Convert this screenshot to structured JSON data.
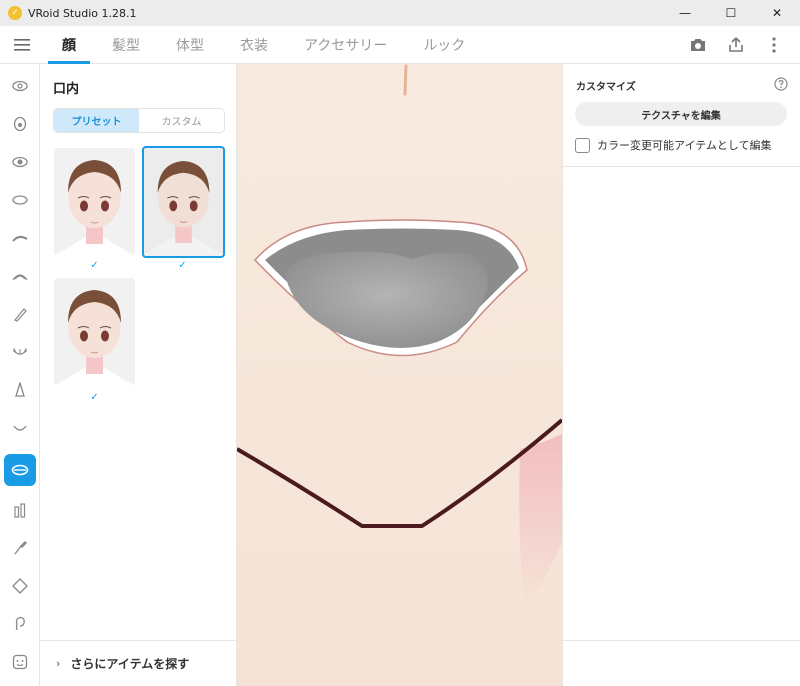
{
  "window": {
    "title": "VRoid Studio 1.28.1",
    "controls": {
      "minimize": "—",
      "maximize": "☐",
      "close": "✕"
    }
  },
  "nav": {
    "tabs": [
      {
        "label": "顔",
        "active": true
      },
      {
        "label": "髪型"
      },
      {
        "label": "体型"
      },
      {
        "label": "衣装"
      },
      {
        "label": "アクセサリー"
      },
      {
        "label": "ルック"
      }
    ],
    "actions": [
      "camera-icon",
      "export-icon",
      "more-icon"
    ]
  },
  "rail": {
    "items": [
      "face-outline-icon",
      "eye-icon",
      "eye-highlight-icon",
      "iris-icon",
      "eyebrow-icon",
      "eyelash-icon",
      "eyeliner-icon",
      "eye-lashes-lower-icon",
      "nose-icon",
      "mouth-icon",
      "mouth-inside-icon",
      "teeth-icon",
      "makeup-icon",
      "face-shape-icon",
      "ear-icon",
      "face-preset-icon"
    ],
    "active_index": 10
  },
  "left_panel": {
    "title": "口内",
    "segments": {
      "preset": "プリセット",
      "custom": "カスタム"
    },
    "check_mark": "✓",
    "more_label": "さらにアイテムを探す",
    "more_chevron": "›"
  },
  "right_panel": {
    "title": "カスタマイズ",
    "edit_texture_label": "テクスチャを編集",
    "checkbox_label": "カラー変更可能アイテムとして編集"
  },
  "colors": {
    "accent": "#1a9be6",
    "skin": "#f7e7dc",
    "lip_outline": "#c98a86",
    "mouth_interior": "#8c8c8c",
    "tongue": "#a8a8a8",
    "jaw_line": "#4a1a1f",
    "blush": "#f2b8bc"
  }
}
